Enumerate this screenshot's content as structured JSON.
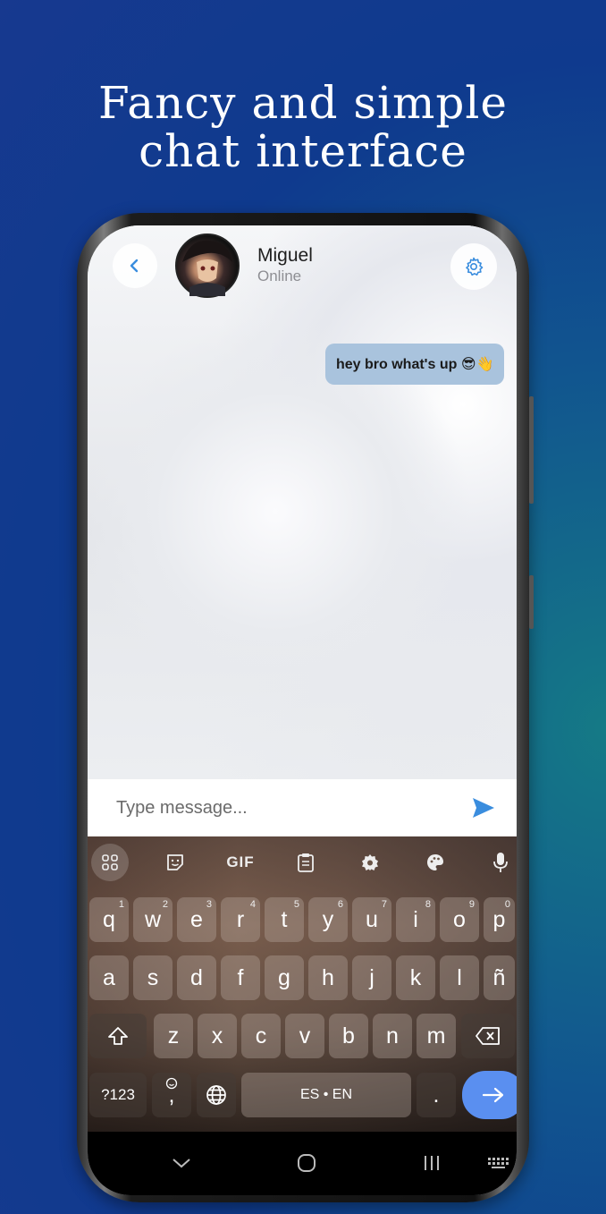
{
  "promo": {
    "headline_line1": "Fancy and simple",
    "headline_line2": "chat interface"
  },
  "header": {
    "contact_name": "Miguel",
    "contact_status": "Online"
  },
  "messages": [
    {
      "text": "hey bro what's up 😎👋",
      "direction": "outgoing"
    }
  ],
  "composer": {
    "placeholder": "Type message..."
  },
  "keyboard": {
    "toolbar": [
      "apps-grid-icon",
      "sticker-icon",
      "GIF",
      "clipboard-icon",
      "gear-icon",
      "palette-icon",
      "mic-icon"
    ],
    "gif_label": "GIF",
    "row1": [
      {
        "k": "q",
        "h": "1"
      },
      {
        "k": "w",
        "h": "2"
      },
      {
        "k": "e",
        "h": "3"
      },
      {
        "k": "r",
        "h": "4"
      },
      {
        "k": "t",
        "h": "5"
      },
      {
        "k": "y",
        "h": "6"
      },
      {
        "k": "u",
        "h": "7"
      },
      {
        "k": "i",
        "h": "8"
      },
      {
        "k": "o",
        "h": "9"
      },
      {
        "k": "p",
        "h": "0"
      }
    ],
    "row2": [
      "a",
      "s",
      "d",
      "f",
      "g",
      "h",
      "j",
      "k",
      "l",
      "ñ"
    ],
    "row3": [
      "z",
      "x",
      "c",
      "v",
      "b",
      "n",
      "m"
    ],
    "symbols_label": "?123",
    "comma_label": ",",
    "space_label": "ES • EN",
    "period_label": "."
  },
  "colors": {
    "accent": "#3a8dde",
    "bubble": "#a9c3dd",
    "enter_key": "#5a8ff0"
  }
}
